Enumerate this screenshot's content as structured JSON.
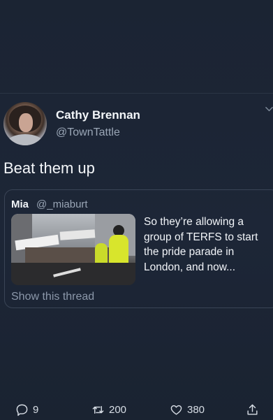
{
  "tweet": {
    "author_name": "Cathy Brennan",
    "author_handle": "@TownTattle",
    "text": "Beat them up",
    "quote": {
      "author_name": "Mia",
      "author_handle": "@_miaburt",
      "text": "So they’re allowing a group of TERFS to start the pride parade in London, and now...",
      "show_thread": "Show this thread"
    },
    "actions": {
      "replies": "9",
      "retweets": "200",
      "likes": "380"
    }
  },
  "icons": {
    "menu": "chevron-down-icon",
    "reply": "reply-icon",
    "retweet": "retweet-icon",
    "like": "heart-icon",
    "share": "share-icon"
  },
  "colors": {
    "background": "#1a2331",
    "muted_text": "#9aa6b6",
    "card_border": "#3a4556"
  }
}
